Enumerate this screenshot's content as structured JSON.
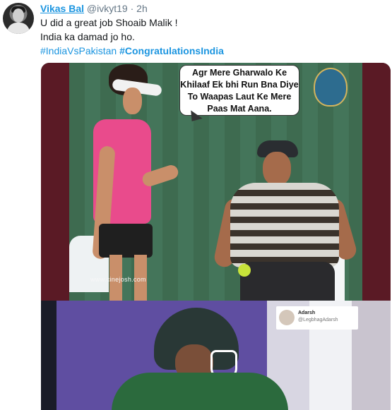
{
  "tweet": {
    "name": "Vikas Bal",
    "handle": "@ivkyt19",
    "separator": "·",
    "time": "2h",
    "line1": "U did a great job Shoaib Malik !",
    "line2": "India ka damad jo ho.",
    "hashtags": [
      "#IndiaVsPakistan",
      "#CongratulationsIndia"
    ]
  },
  "meme": {
    "speech": "Agr Mere Gharwalo Ke Khilaaf Ek bhi Run Bna Diye To Waapas Laut Ke Mere Paas Mat Aana.",
    "watermark": "www.cinejosh.com",
    "card_name": "Adarsh",
    "card_handle": "@LegbhagAdarsh"
  },
  "colors": {
    "link": "#1b95e0",
    "muted": "#657786"
  }
}
